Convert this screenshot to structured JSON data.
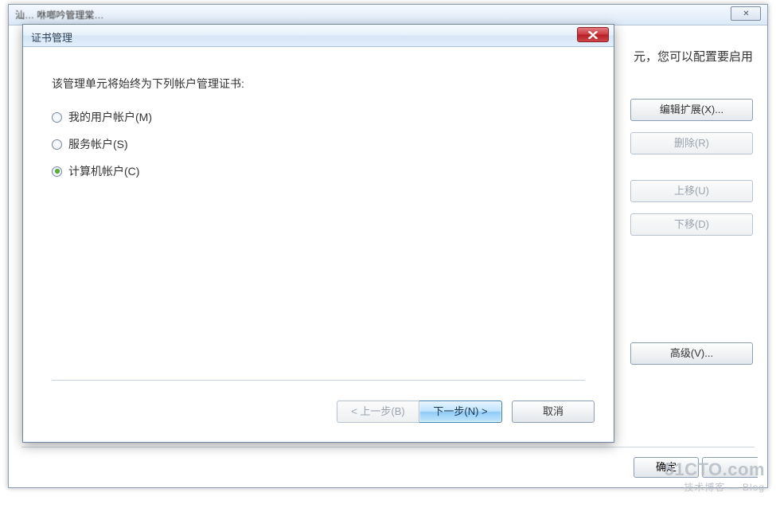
{
  "bg_window": {
    "title_fragment": "汕… 咻啷吟管理棠…",
    "right_text": "元，您可以配置要启用",
    "buttons": {
      "edit_ext": "编辑扩展(X)...",
      "remove": "删除(R)",
      "move_up": "上移(U)",
      "move_down": "下移(D)",
      "advanced": "高级(V)...",
      "ok": "确定"
    },
    "close_glyph": "✕"
  },
  "dialog": {
    "title": "证书管理",
    "instruction": "该管理单元将始终为下列帐户管理证书:",
    "options": [
      {
        "label": "我的用户帐户(M)",
        "checked": false
      },
      {
        "label": "服务帐户(S)",
        "checked": false
      },
      {
        "label": "计算机帐户(C)",
        "checked": true
      }
    ],
    "buttons": {
      "back": "< 上一步(B)",
      "next": "下一步(N) >",
      "cancel": "取消"
    }
  },
  "watermark": {
    "line1": "51CTO.com",
    "line2": "技术博客 — Blog"
  }
}
